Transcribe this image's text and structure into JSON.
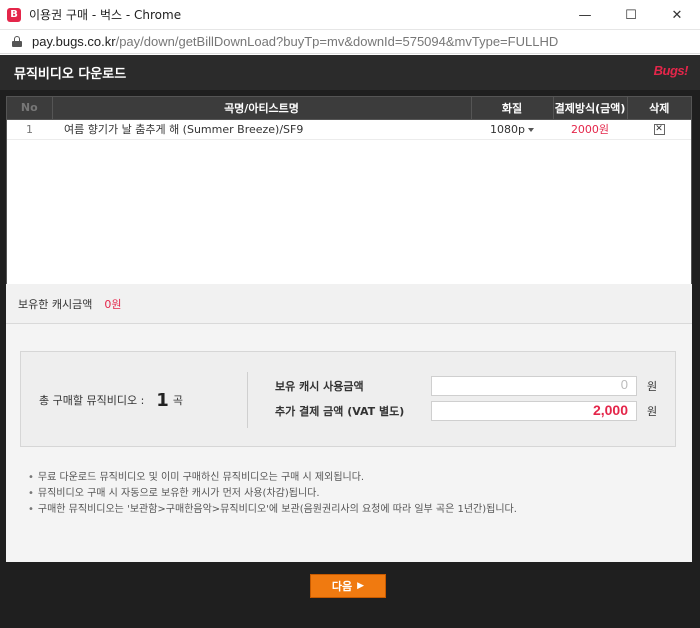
{
  "window": {
    "icon_letter": "B",
    "title": "이용권 구매 - 벅스 - Chrome",
    "minimize": "—",
    "maximize": "☐",
    "close": "✕"
  },
  "address": {
    "host": "pay.bugs.co.kr",
    "path": "/pay/down/getBillDownLoad?buyTp=mv&downId=575094&mvType=FULLHD"
  },
  "header": {
    "title": "뮤직비디오 다운로드",
    "logo": "Bugs!"
  },
  "table": {
    "columns": [
      "No",
      "곡명/아티스트명",
      "화질",
      "결제방식(금액)",
      "삭제"
    ],
    "rows": [
      {
        "no": "1",
        "title": "여름 향기가 날 춤추게 해 (Summer Breeze)/SF9",
        "quality": "1080p",
        "price": "2000원",
        "delete": "✕"
      }
    ]
  },
  "cash": {
    "label": "보유한 캐시금액",
    "amount": "0원"
  },
  "summary": {
    "total_label": "총 구매할 뮤직비디오 :",
    "total_count": "1",
    "total_unit": "곡",
    "cash_use_label": "보유 캐시 사용금액",
    "cash_use_value": "0",
    "extra_label": "추가 결제 금액 (VAT 별도)",
    "extra_value": "2,000",
    "won": "원"
  },
  "notices": [
    "무료 다운로드 뮤직비디오 및 이미 구매하신 뮤직비디오는 구매 시 제외됩니다.",
    "뮤직비디오 구매 시 자동으로 보유한 캐시가 먼저 사용(차감)됩니다.",
    "구매한 뮤직비디오는 '보관함>구매한음악>뮤직비디오'에 보관(음원권리사의 요청에 따라 일부 곡은 1년간)됩니다."
  ],
  "footer": {
    "next_label": "다음",
    "next_arrow": "▶"
  },
  "colors": {
    "accent_red": "#e4264a",
    "button_orange": "#f07a10",
    "dark_bg": "#1f1f1f"
  }
}
